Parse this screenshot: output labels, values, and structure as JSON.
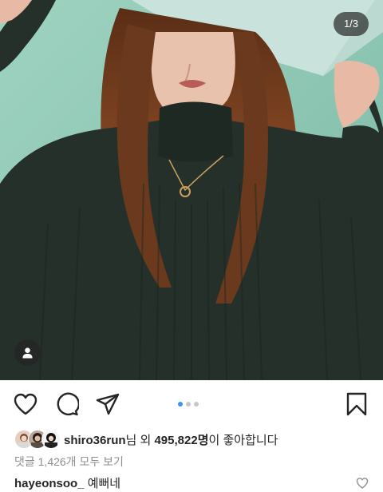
{
  "post": {
    "counter": "1/3",
    "likes": {
      "user": "shiro36run",
      "middle": "님 외 ",
      "count": "495,822명",
      "suffix": "이 좋아합니다"
    },
    "view_comments": "댓글 1,426개 모두 보기",
    "comment": {
      "user": "hayeonsoo_",
      "text": "예뻐네"
    }
  },
  "carousel": {
    "total": 3,
    "active_index": 0
  },
  "colors": {
    "backdrop": "#8fc7b3",
    "sweater": "#25302a",
    "hair": "#6b3a1e",
    "dot_active": "#3897f0",
    "dot_inactive": "#c7c7c7",
    "text": "#262626",
    "muted": "#8e8e8e"
  },
  "icons": {
    "like": "heart-outline-icon",
    "comment": "comment-bubble-icon",
    "share": "paper-plane-icon",
    "save": "bookmark-outline-icon",
    "user_tag": "person-icon",
    "comment_like": "small-heart-icon"
  }
}
